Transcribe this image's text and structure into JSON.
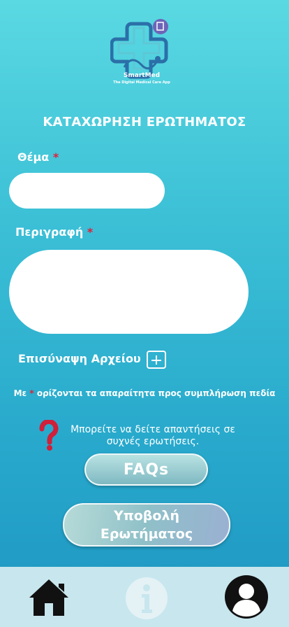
{
  "brand": {
    "name": "SmartMed",
    "tagline": "The Digital Medical Care App"
  },
  "page": {
    "title": "ΚΑΤΑΧΩΡΗΣΗ ΕΡΩΤΗΜΑΤΟΣ"
  },
  "form": {
    "subject": {
      "label": "Θέμα",
      "required_mark": "*",
      "value": "",
      "placeholder": ""
    },
    "description": {
      "label": "Περιγραφή",
      "required_mark": "*",
      "value": "",
      "placeholder": ""
    },
    "attachment": {
      "label": "Επισύναψη Αρχείου"
    },
    "required_note": {
      "prefix": "Με",
      "mark": "*",
      "suffix": "ορίζονται τα απαραίτητα προς συμπλήρωση πεδία"
    }
  },
  "faq": {
    "hint_line1": "Μπορείτε να δείτε απαντήσεις σε",
    "hint_line2": "συχνές ερωτήσεις.",
    "button_label": "FAQs"
  },
  "submit": {
    "line1": "Υποβολή",
    "line2": "Ερωτήματος"
  },
  "bottom_nav": {
    "items": [
      {
        "icon": "home-icon",
        "active": true
      },
      {
        "icon": "info-icon",
        "active": false
      },
      {
        "icon": "profile-icon",
        "active": true
      }
    ]
  },
  "colors": {
    "required": "#e0203a",
    "question_icon": "#d0203a",
    "nav_bg": "#c8e6ee",
    "nav_icon": "#111111",
    "nav_icon_disabled": "#e4f2f5"
  }
}
